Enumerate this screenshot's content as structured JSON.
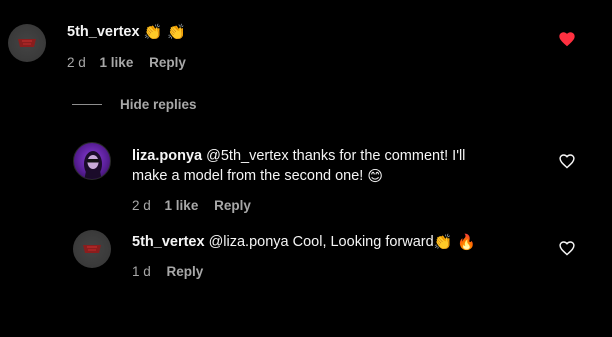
{
  "comments": [
    {
      "username": "5th_vertex",
      "text": "",
      "emojis": "👏 👏",
      "time": "2 d",
      "likes": "1 like",
      "reply": "Reply",
      "liked": true
    },
    {
      "username": "liza.ponya",
      "text_line1": "@5th_vertex thanks for the comment! I'll",
      "text_line2": "make a model from the second one!",
      "emoji": "😊",
      "time": "2 d",
      "likes": "1 like",
      "reply": "Reply",
      "liked": false
    },
    {
      "username": "5th_vertex",
      "text": "@liza.ponya Cool, Looking forward",
      "emojis": "👏 🔥",
      "time": "1 d",
      "reply": "Reply",
      "liked": false
    }
  ],
  "hide_replies_label": "Hide replies",
  "colors": {
    "background": "#000000",
    "text": "#f5f5f5",
    "muted": "#a8a8a8",
    "heart_liked": "#ff3040"
  },
  "icons": {
    "liked": "heart-filled-icon",
    "unliked": "heart-outline-icon"
  }
}
